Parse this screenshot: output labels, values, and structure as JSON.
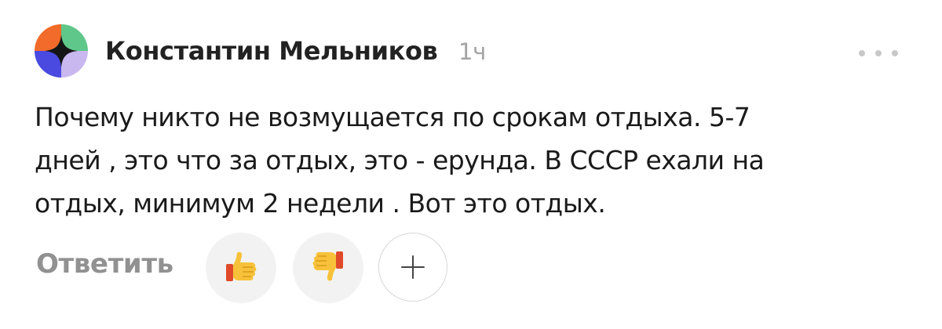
{
  "comment": {
    "author": "Константин Мельников",
    "time": "1ч",
    "text_lines": [
      "Почему никто не возмущается по срокам отдыха. 5-7",
      "дней , это что за отдых, это - ерунда. В СССР ехали на",
      "отдых, минимум 2 недели . Вот это отдых."
    ],
    "reply_label": "Ответить"
  },
  "icons": {
    "avatar": "avatar-icon",
    "menu": "more-dots-icon",
    "like": "thumbs-up-icon",
    "dislike": "thumbs-down-icon",
    "add_reaction": "plus-icon"
  },
  "colors": {
    "avatar_orange": "#f26b2a",
    "avatar_green": "#5fc78a",
    "avatar_blue": "#4a4ae0",
    "avatar_lilac": "#c9b8f0",
    "text": "#1a1a1a",
    "muted": "#a3a3a3",
    "reaction_bg": "#f2f2f2",
    "thumb_yellow": "#f7c23a"
  }
}
